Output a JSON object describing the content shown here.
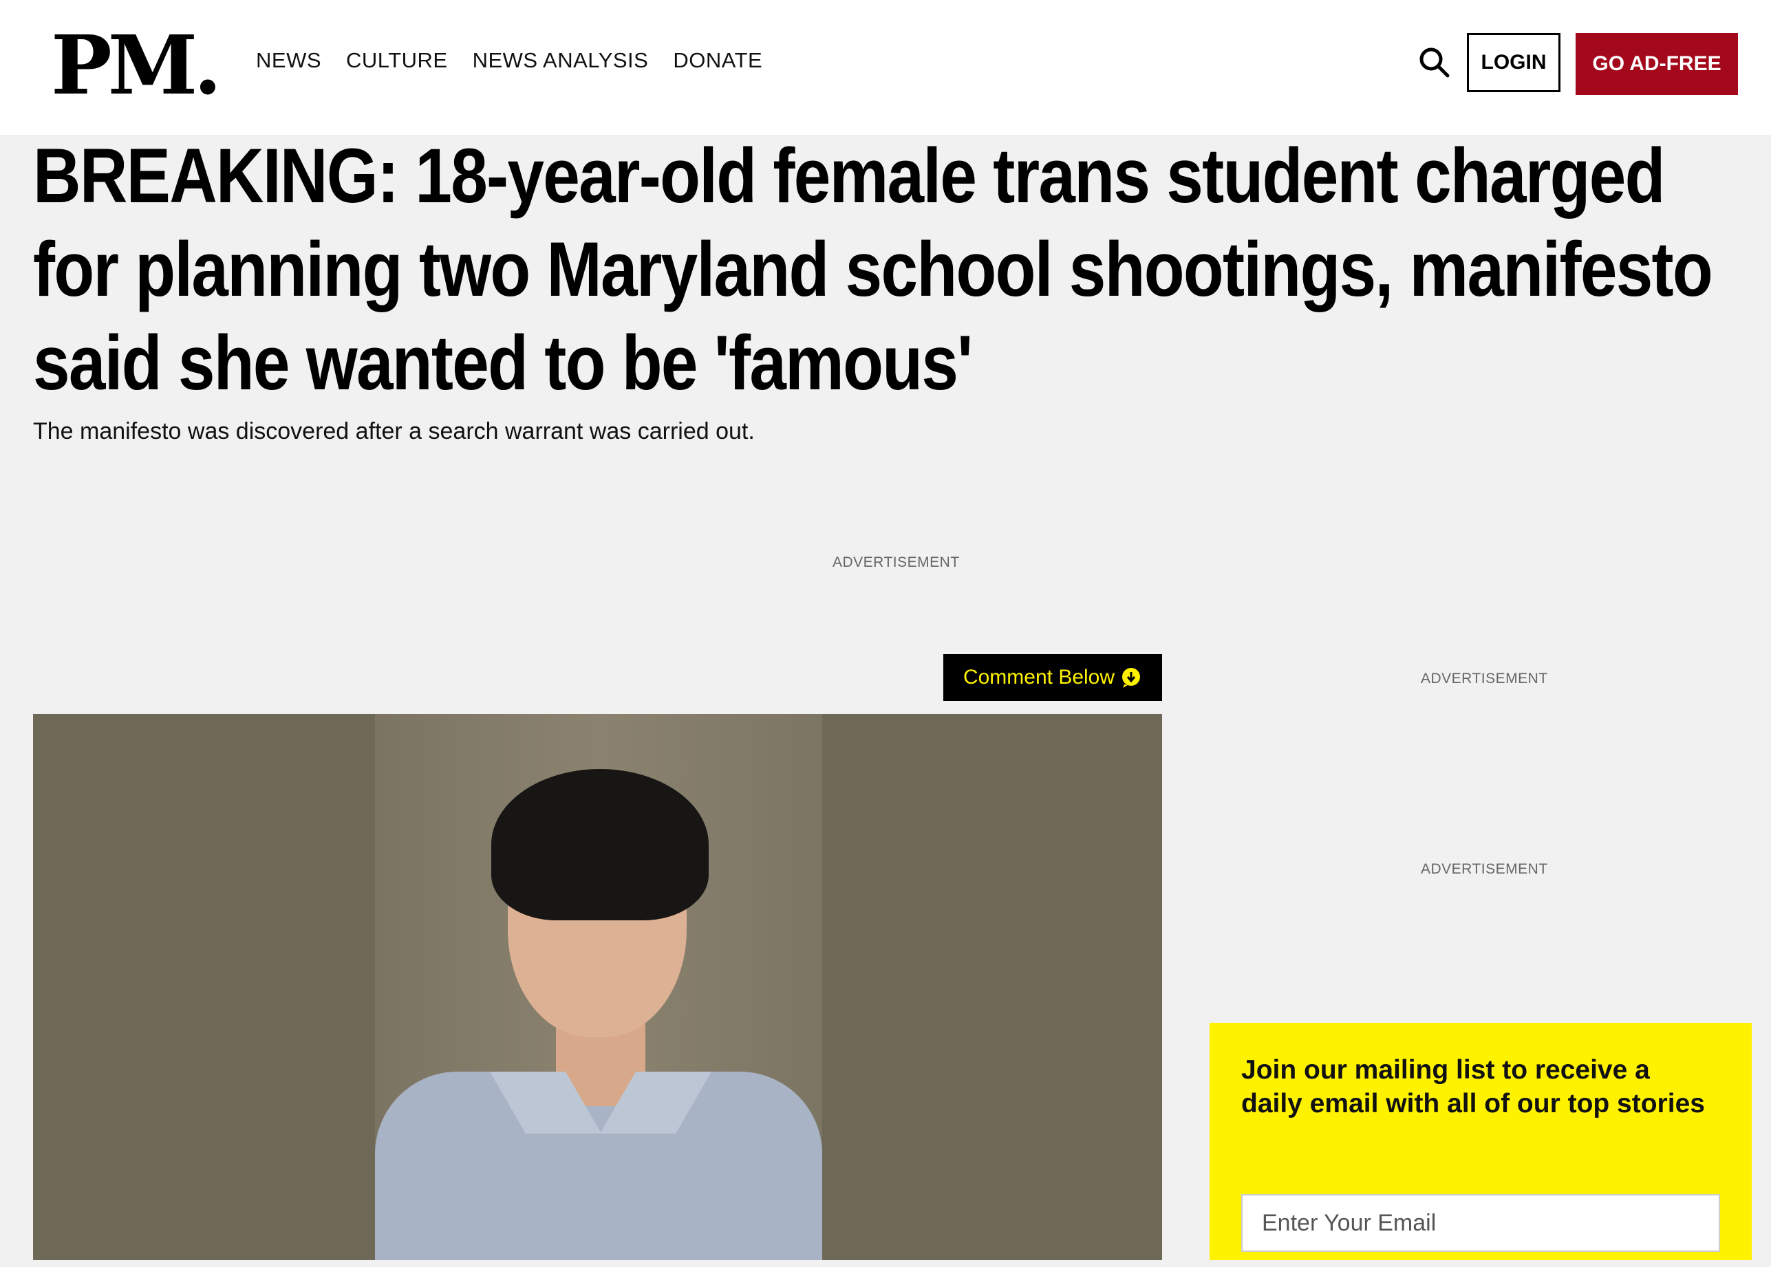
{
  "header": {
    "logo": "PM.",
    "nav": [
      "NEWS",
      "CULTURE",
      "NEWS ANALYSIS",
      "DONATE"
    ],
    "search_icon": "search-icon",
    "login_label": "LOGIN",
    "adfree_label": "GO AD-FREE",
    "accent_color": "#a3091b"
  },
  "article": {
    "headline": "BREAKING: 18-year-old female trans student charged for planning two Maryland school shootings, manifesto said she wanted to be 'famous'",
    "subheadline": "The manifesto was discovered after a search warrant was carried out.",
    "ad_label": "ADVERTISEMENT",
    "comment_label": "Comment Below",
    "comment_icon": "comment-arrow-icon"
  },
  "sidebar": {
    "ad_label_1": "ADVERTISEMENT",
    "ad_label_2": "ADVERTISEMENT",
    "newsletter": {
      "text": "Join our mailing list to receive a daily email with all of our top stories",
      "email_placeholder": "Enter Your Email",
      "background": "#fff200"
    }
  }
}
